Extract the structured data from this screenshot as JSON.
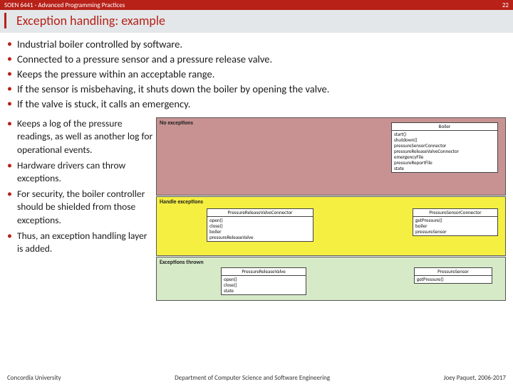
{
  "header": {
    "course": "SOEN 6441 - Advanced Programming Practices",
    "page": "22"
  },
  "title": "Exception handling: example",
  "top_bullets": [
    "Industrial boiler controlled by software.",
    "Connected to a pressure sensor and a pressure release valve.",
    "Keeps the pressure within an acceptable range.",
    "If the sensor is misbehaving, it shuts down the boiler by opening the valve.",
    "If the valve is stuck, it calls an emergency."
  ],
  "left_bullets": [
    "Keeps a log of the pressure readings, as well as another log for operational events.",
    "Hardware drivers can throw exceptions.",
    "For security, the boiler controller should be shielded from those exceptions.",
    "Thus, an exception handling layer is added."
  ],
  "diagram": {
    "layers": [
      {
        "label": "No exceptions",
        "boxes": [
          {
            "name": "Boiler",
            "members": [
              "start()",
              "shutdown()",
              "pressureSensorConnector",
              "pressureReleaseValveConnector",
              "emergencyFile",
              "pressureReportFile",
              "state"
            ]
          }
        ]
      },
      {
        "label": "Handle exceptions",
        "boxes": [
          {
            "name": "PressureReleaseValveConnector",
            "members": [
              "open()",
              "close()",
              "boiler",
              "pressureReleaseValve"
            ]
          },
          {
            "name": "PressureSensorConnector",
            "members": [
              "getPressure()",
              "boiler",
              "pressureSensor"
            ]
          }
        ]
      },
      {
        "label": "Exceptions thrown",
        "boxes": [
          {
            "name": "PressureReleaseValve",
            "members": [
              "open()",
              "close()",
              "state"
            ]
          },
          {
            "name": "PressureSensor",
            "members": [
              "getPressure()"
            ]
          }
        ]
      }
    ]
  },
  "footer": {
    "left": "Concordia University",
    "center": "Department of Computer Science and Software Engineering",
    "right": "Joey Paquet, 2006-2017"
  }
}
